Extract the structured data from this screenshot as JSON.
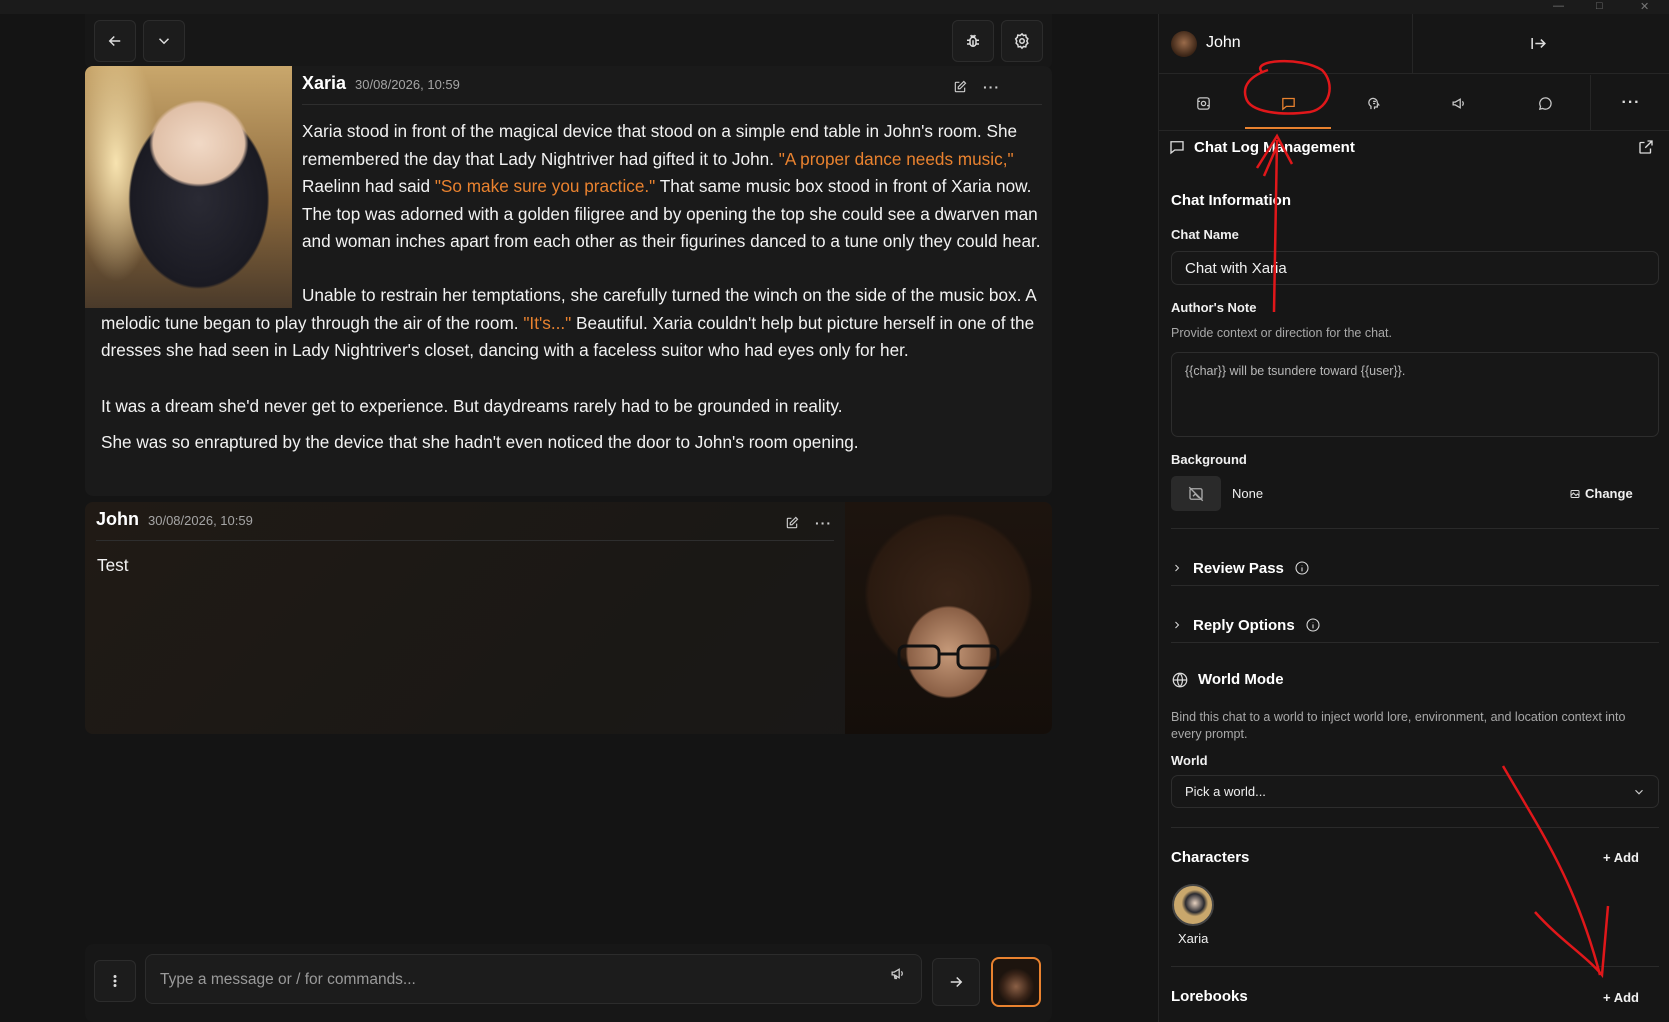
{
  "chat": {
    "xaria": {
      "name": "Xaria",
      "time": "30/08/2026, 10:59",
      "p1_a": "Xaria stood in front of the magical device that stood on a simple end table in John's room. She remembered the day that Lady Nightriver had gifted it to John. ",
      "p1_q1": "\"A proper dance needs music,\"",
      "p1_b": " Raelinn had said ",
      "p1_q2": "\"So make sure you practice.\"",
      "p1_c": " That same music box stood in front of Xaria now. The top was adorned with a golden filigree and by opening the top she could see a dwarven man and woman inches apart from each other as their figurines danced to a tune only they could hear.",
      "p2_a": "Unable to restrain her temptations, she carefully turned the winch on the side of the music box. A melodic tune began to play through the air of the room. ",
      "p2_q": "\"It's...\"",
      "p2_b": " Beautiful. Xaria couldn't help but picture herself in one of the dresses she had seen in Lady Nightriver's closet, dancing with a faceless suitor who had eyes only for her.",
      "p3": "It was a dream she'd never get to experience. But daydreams rarely had to be grounded in reality.",
      "p4": "She was so enraptured by the device that she hadn't even noticed the door to John's room opening."
    },
    "john": {
      "name": "John",
      "time": "30/08/2026, 10:59",
      "text": "Test"
    },
    "input_placeholder": "Type a message or / for commands..."
  },
  "panel": {
    "user_name": "John",
    "section_title": "Chat Log Management",
    "chat_info_title": "Chat Information",
    "chat_name_label": "Chat Name",
    "chat_name_value": "Chat with Xaria",
    "authors_note_label": "Author's Note",
    "authors_note_hint": "Provide context or direction for the chat.",
    "authors_note_value": "{{char}} will be tsundere toward {{user}}.",
    "background_label": "Background",
    "background_value": "None",
    "background_change": "Change",
    "review_pass": "Review Pass",
    "reply_options": "Reply Options",
    "world_mode_title": "World Mode",
    "world_mode_hint": "Bind this chat to a world to inject world lore, environment, and location context into every prompt.",
    "world_label": "World",
    "world_select": "Pick a world...",
    "characters_title": "Characters",
    "characters_add": "+ Add",
    "character_name": "Xaria",
    "lorebooks_title": "Lorebooks",
    "lorebooks_add": "+ Add"
  },
  "colors": {
    "accent": "#e9822f",
    "annotation": "#e0171a"
  }
}
